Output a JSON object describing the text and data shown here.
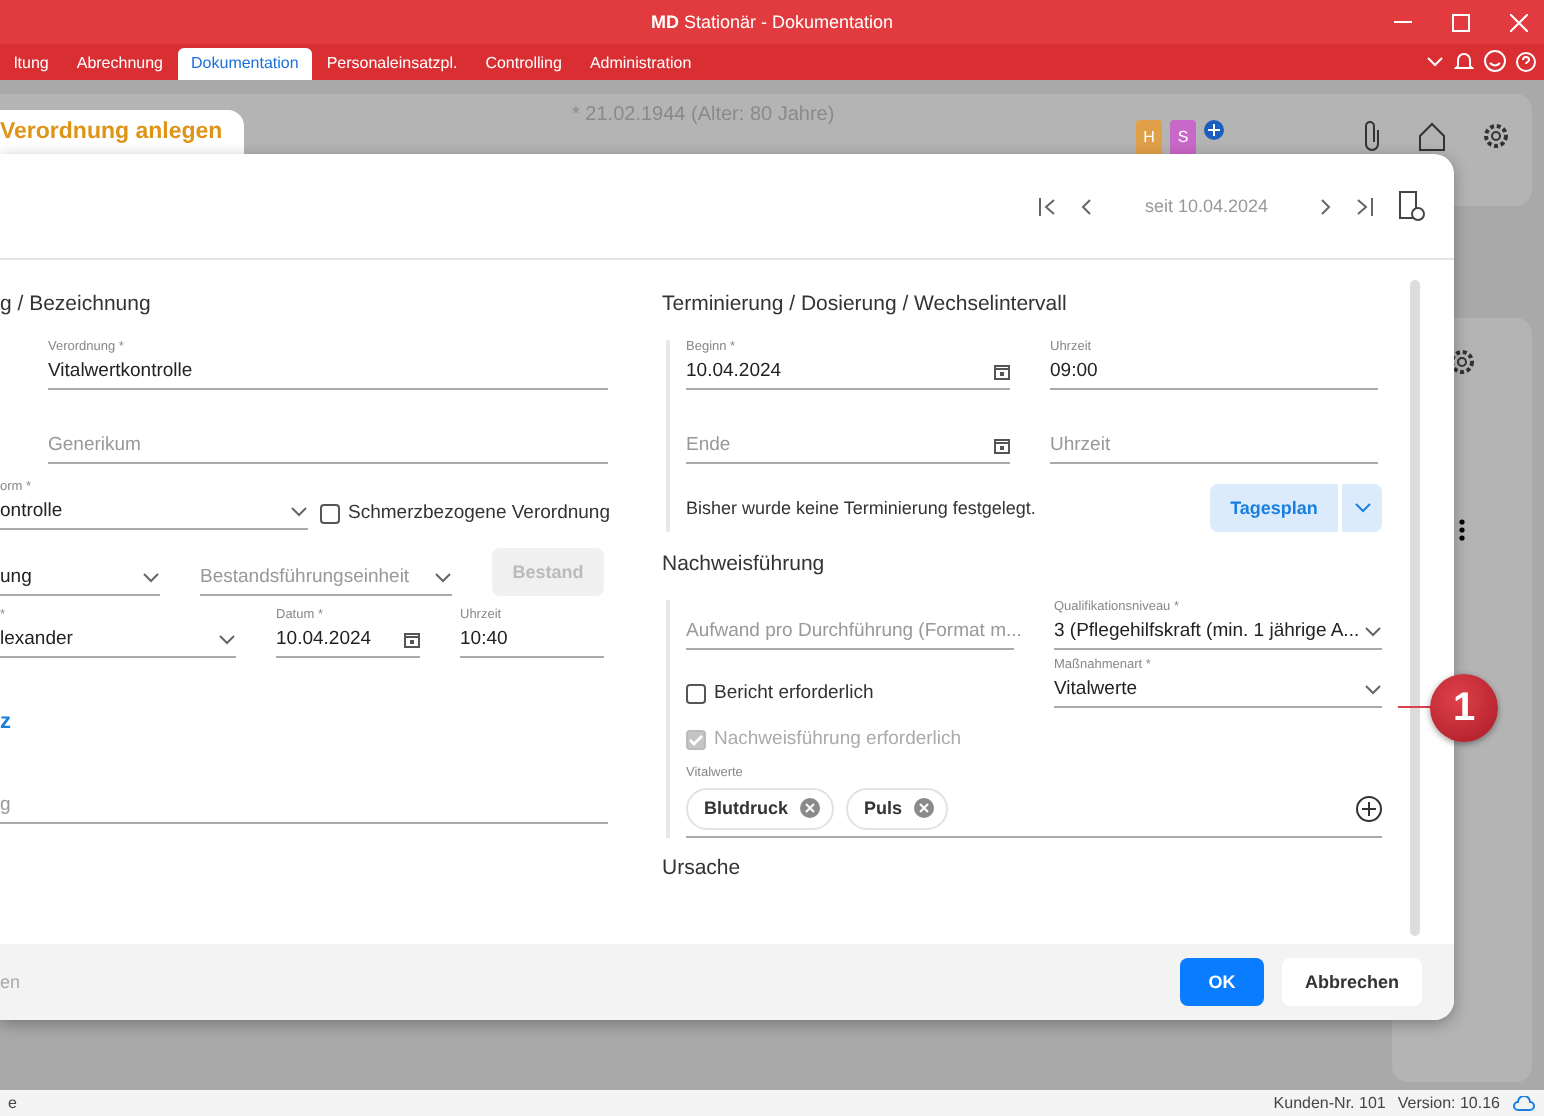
{
  "window": {
    "brand": "MD",
    "title": "Stationär - Dokumentation"
  },
  "menu": [
    {
      "label": "ltung",
      "selected": false
    },
    {
      "label": "Abrechnung",
      "selected": false
    },
    {
      "label": "Dokumentation",
      "selected": true
    },
    {
      "label": "Personaleinsatzpl.",
      "selected": false
    },
    {
      "label": "Controlling",
      "selected": false
    },
    {
      "label": "Administration",
      "selected": false
    }
  ],
  "background": {
    "patient_info": "* 21.02.1944 (Alter: 80 Jahre)",
    "tags": [
      {
        "label": "H",
        "color": "#e0a048"
      },
      {
        "label": "S",
        "color": "#c868c8"
      }
    ]
  },
  "dialog": {
    "tab": "Verordnung anlegen",
    "since": "seit 10.04.2024",
    "left": {
      "title": "g / Bezeichnung",
      "verordnung": {
        "label": "Verordnung *",
        "value": "Vitalwertkontrolle"
      },
      "generikum": {
        "placeholder": "Generikum"
      },
      "form": {
        "label": "orm *",
        "value": "ontrolle"
      },
      "pain": {
        "label": "Schmerzbezogene Verordnung",
        "checked": false
      },
      "unit1": {
        "value": "ung"
      },
      "unit2": {
        "placeholder": "Bestandsführungseinheit"
      },
      "stock_button": {
        "label": "Bestand",
        "disabled": true
      },
      "person": {
        "label": "*",
        "value": "lexander"
      },
      "date": {
        "label": "Datum *",
        "value": "10.04.2024"
      },
      "time": {
        "label": "Uhrzeit",
        "value": "10:40"
      },
      "link": "z",
      "note": {
        "placeholder": "g"
      }
    },
    "right": {
      "title": "Terminierung / Dosierung / Wechselintervall",
      "start": {
        "label": "Beginn *",
        "value": "10.04.2024"
      },
      "start_time": {
        "label": "Uhrzeit",
        "value": "09:00"
      },
      "end": {
        "placeholder": "Ende"
      },
      "end_time": {
        "placeholder": "Uhrzeit"
      },
      "info": "Bisher wurde keine Terminierung festgelegt.",
      "plan_button": "Tagesplan",
      "proof_title": "Nachweisführung",
      "effort": {
        "placeholder": "Aufwand pro Durchführung (Format m..."
      },
      "qualification": {
        "label": "Qualifikationsniveau *",
        "value": "3 (Pflegehilfskraft (min. 1 jährige A..."
      },
      "report": {
        "label": "Bericht erforderlich",
        "checked": false,
        "disabled": false
      },
      "measure": {
        "label": "Maßnahmenart *",
        "value": "Vitalwerte"
      },
      "proof": {
        "label": "Nachweisführung erforderlich",
        "checked": true,
        "disabled": true
      },
      "vitals": {
        "label": "Vitalwerte",
        "chips": [
          "Blutdruck",
          "Puls"
        ]
      },
      "cause_title": "Ursache"
    },
    "footer_left": "en",
    "ok": "OK",
    "cancel": "Abbrechen"
  },
  "callout": "1",
  "status": {
    "left": "e",
    "customer": "Kunden-Nr. 101",
    "version": "Version: 10.16"
  }
}
